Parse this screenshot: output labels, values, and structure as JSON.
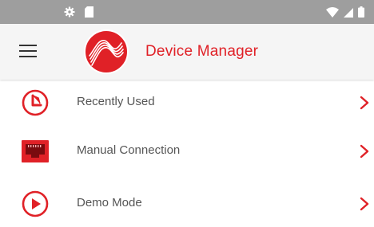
{
  "colors": {
    "accent": "#e02127",
    "status_bar": "#9e9e9e",
    "app_bar": "#f5f5f5"
  },
  "status_bar": {
    "left_icons": [
      "gear-icon",
      "sd-card-icon"
    ],
    "right_icons": [
      "wifi-icon",
      "signal-icon",
      "battery-icon"
    ]
  },
  "app_bar": {
    "menu_icon": "hamburger-menu-icon",
    "logo_icon": "brand-wave-logo-icon",
    "title": "Device Manager"
  },
  "menu": {
    "items": [
      {
        "label": "Recently Used",
        "icon": "history-clock-icon"
      },
      {
        "label": "Manual Connection",
        "icon": "ethernet-port-icon"
      },
      {
        "label": "Demo Mode",
        "icon": "play-icon"
      }
    ]
  }
}
